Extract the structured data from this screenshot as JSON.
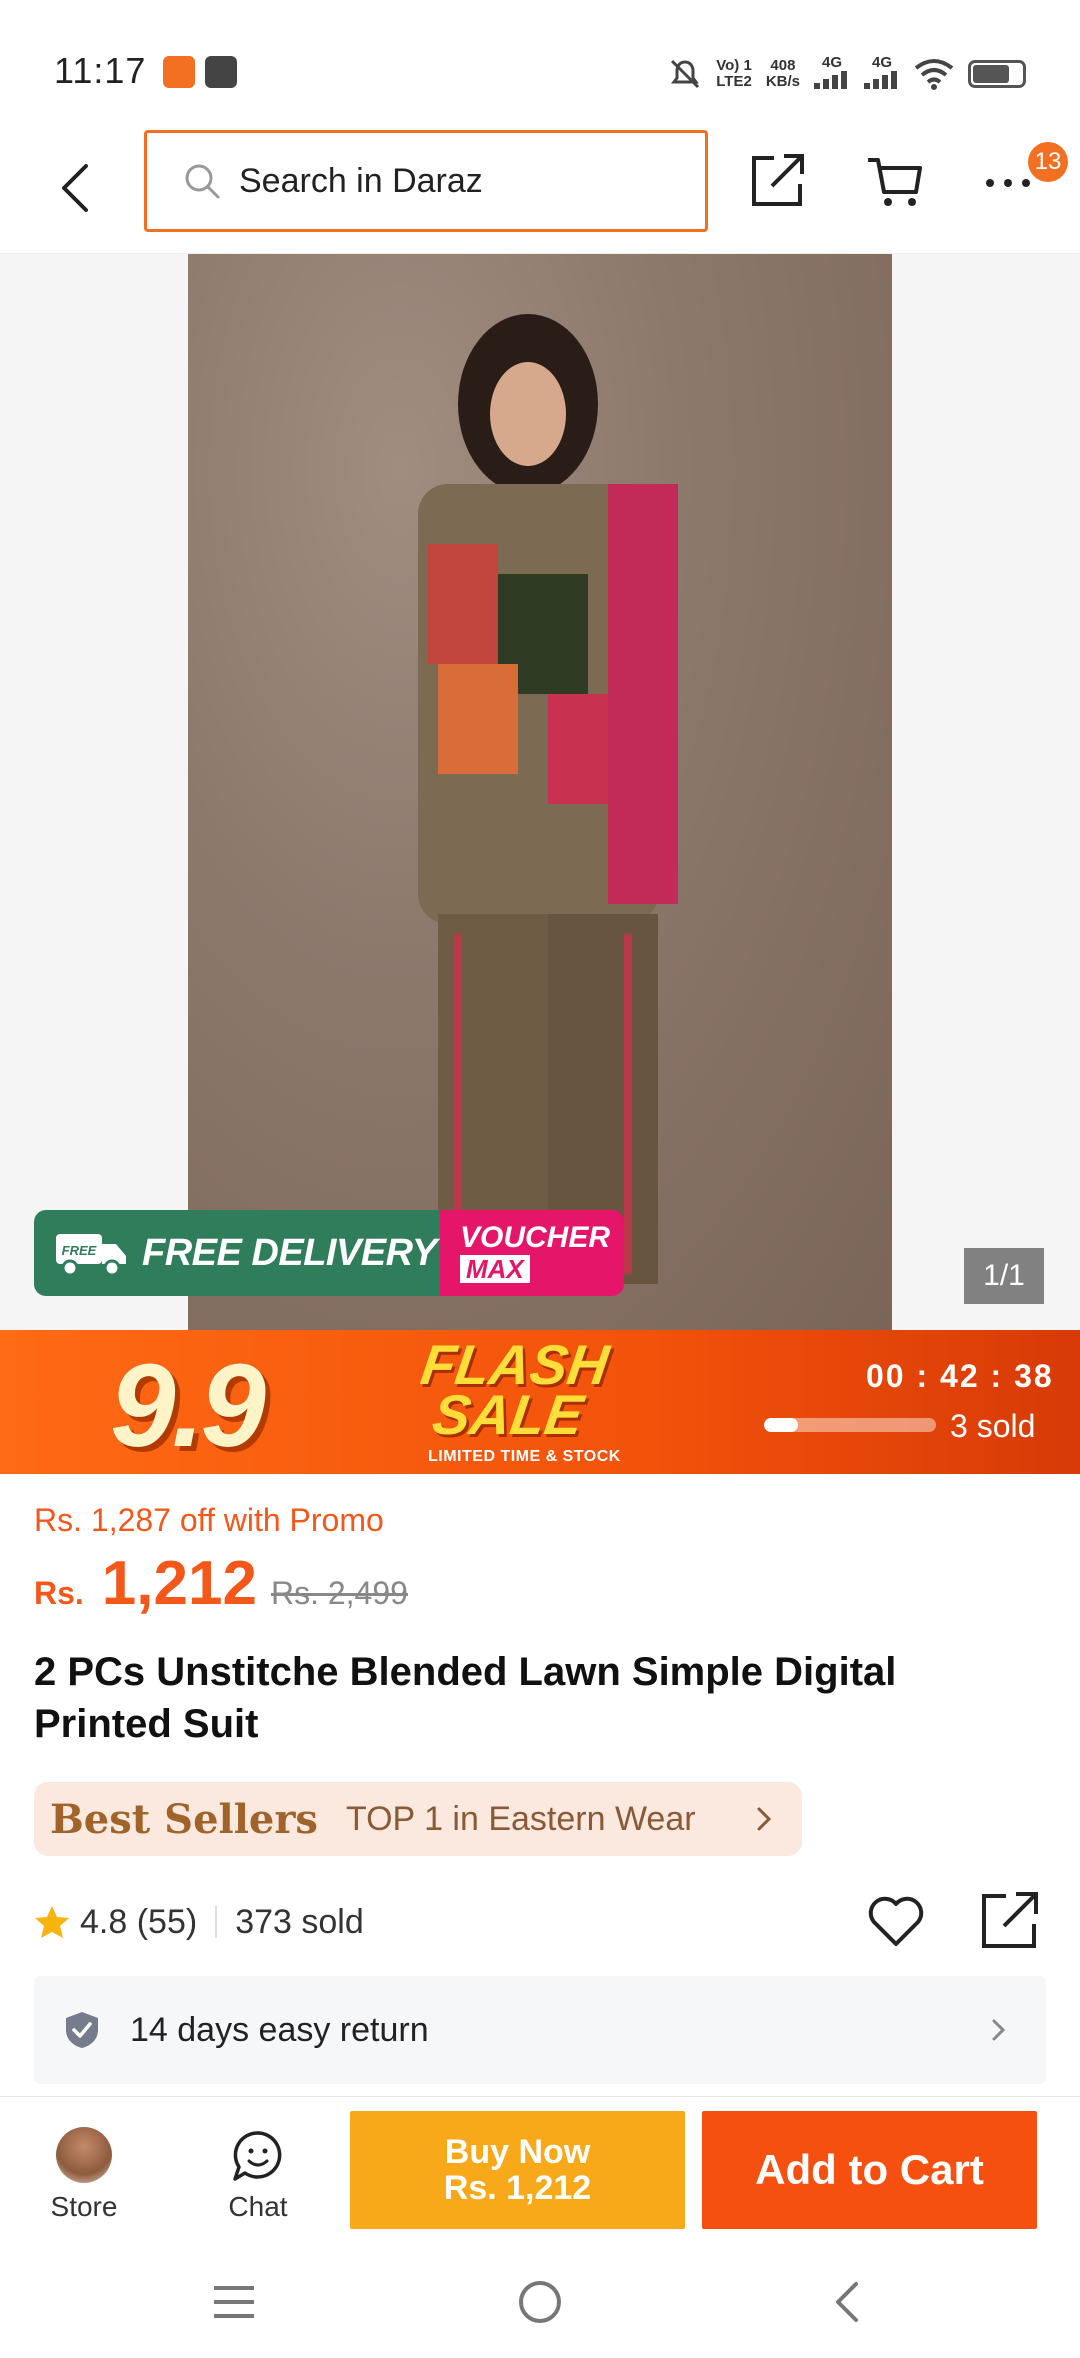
{
  "status_bar": {
    "time": "11:17",
    "network_label_1": "Vo) 1",
    "network_label_2": "LTE2",
    "speed_value": "408",
    "speed_unit": "KB/s",
    "signal_1": "4G",
    "signal_2": "4G"
  },
  "header": {
    "search_placeholder": "Search in Daraz",
    "notification_count": "13"
  },
  "gallery": {
    "page_indicator": "1/1",
    "delivery_badge": "FREE DELIVERY",
    "delivery_truck_text": "FREE",
    "voucher_line1": "VOUCHER",
    "voucher_line2": "MAX"
  },
  "flash_sale": {
    "event_label": "9.9",
    "title_line1": "FLASH",
    "title_line2": "SALE",
    "subtitle": "LIMITED TIME & STOCK",
    "countdown": "00 : 42 : 38",
    "sold_text": "3 sold",
    "sold_progress": 0.2
  },
  "price": {
    "promo_text": "Rs. 1,287 off with Promo",
    "currency": "Rs.",
    "current": "1,212",
    "original": "Rs. 2,499"
  },
  "product": {
    "title": "2 PCs Unstitche Blended Lawn Simple Digital Printed Suit"
  },
  "bestseller": {
    "badge": "Best Sellers",
    "text": "TOP 1 in Eastern Wear"
  },
  "rating": {
    "score_text": "4.8 (55)",
    "sold_text": "373 sold"
  },
  "service": {
    "return_text": "14 days easy return"
  },
  "action_bar": {
    "store_label": "Store",
    "chat_label": "Chat",
    "buy_now_label": "Buy Now",
    "buy_now_price": "Rs. 1,212",
    "add_to_cart_label": "Add to Cart"
  },
  "colors": {
    "brand_orange": "#f36f21",
    "price_orange": "#f3581a",
    "buy_now_yellow": "#f8a91a",
    "add_cart_orange": "#f5500f",
    "delivery_green": "#2f7d5a",
    "voucher_pink": "#e5166a"
  },
  "icons": [
    "back-icon",
    "search-icon",
    "share-icon",
    "cart-icon",
    "more-icon",
    "truck-icon",
    "star-icon",
    "heart-icon",
    "shield-icon",
    "chevron-right-icon",
    "chat-icon",
    "menu-icon",
    "home-icon",
    "nav-back-icon"
  ]
}
